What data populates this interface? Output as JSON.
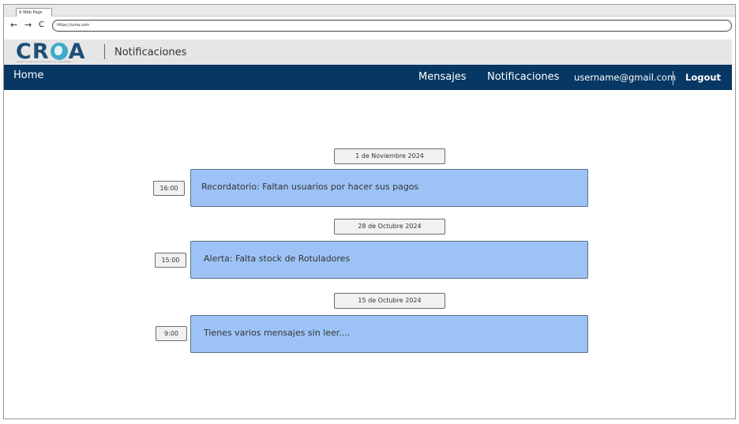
{
  "browser": {
    "tab_title": "A Web Page",
    "back_icon": "←",
    "forward_icon": "→",
    "reload_icon": "C",
    "url": "https://uma.com"
  },
  "header": {
    "logo_text_left": "CR",
    "logo_text_right": "A",
    "logo_tagline": "Centro de Recursos Orientados al Aprendizaje",
    "page_title": "Notificaciones"
  },
  "navbar": {
    "home": "Home",
    "mensajes": "Mensajes",
    "notificaciones": "Notificaciones",
    "user_email": "username@gmail.com",
    "logout": "Logout"
  },
  "notifications": [
    {
      "date": "1 de Noviembre 2024",
      "time": "16:00",
      "message": "Recordatorio: Faltan usuarios por hacer sus pagos"
    },
    {
      "date": "28 de Octubre 2024",
      "time": "15:00",
      "message": "Alerta: Falta stock de Rotuladores"
    },
    {
      "date": "15 de Octubre 2024",
      "time": "9:00",
      "message": "Tienes varios mensajes sin leer...."
    }
  ],
  "colors": {
    "navbar_bg": "#073763",
    "card_bg": "#9dc3f6",
    "logo_blue": "#1c4f78"
  }
}
